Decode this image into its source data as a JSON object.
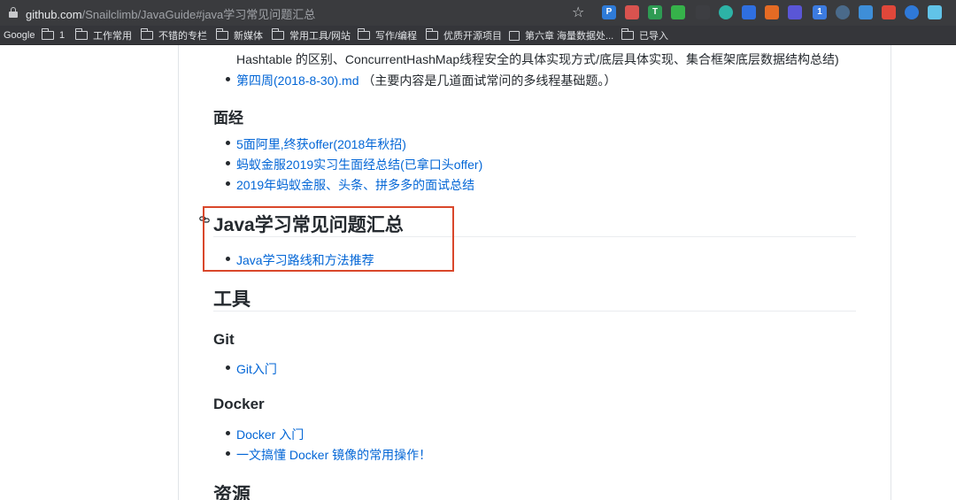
{
  "browser": {
    "url_host": "github.com",
    "url_path": "/Snailclimb/JavaGuide#java学习常见问题汇总",
    "extensions": [
      {
        "name": "p-icon",
        "label": "P",
        "color": "#2f7bd8"
      },
      {
        "name": "pdf-icon",
        "label": "",
        "color": "#d9534f"
      },
      {
        "name": "t-icon",
        "label": "T",
        "color": "#2e9b53"
      },
      {
        "name": "shield-play-icon",
        "label": "",
        "color": "#36b24a"
      },
      {
        "name": "diamond-icon",
        "label": "",
        "color": "#3d3e42"
      },
      {
        "name": "teal-circle-icon",
        "label": "",
        "color": "#2db3a6"
      },
      {
        "name": "blue-arrow-icon",
        "label": "",
        "color": "#2f6fe0"
      },
      {
        "name": "orange-face-icon",
        "label": "",
        "color": "#e56b24"
      },
      {
        "name": "moon-icon",
        "label": "",
        "color": "#5a56d6"
      },
      {
        "name": "badge-icon",
        "label": "1",
        "color": "#3c7be0"
      },
      {
        "name": "ring-icon",
        "label": "",
        "color": "#4a6a8a"
      },
      {
        "name": "grid-icon",
        "label": "",
        "color": "#3e8ed8"
      },
      {
        "name": "red-square-icon",
        "label": "",
        "color": "#e0473a"
      },
      {
        "name": "blue-ring-icon",
        "label": "",
        "color": "#2f79d8"
      },
      {
        "name": "react-icon",
        "label": "",
        "color": "#61c3e8"
      }
    ]
  },
  "bookmarks": [
    {
      "label": "Google",
      "icon": "none"
    },
    {
      "label": "1",
      "icon": "folder-icon"
    },
    {
      "label": "工作常用",
      "icon": "folder-icon"
    },
    {
      "label": "不错的专栏",
      "icon": "folder-icon"
    },
    {
      "label": "新媒体",
      "icon": "folder-icon"
    },
    {
      "label": "常用工具/网站",
      "icon": "folder-icon"
    },
    {
      "label": "写作/编程",
      "icon": "folder-icon"
    },
    {
      "label": "优质开源项目",
      "icon": "folder-icon"
    },
    {
      "label": "第六章 海量数据处...",
      "icon": "book-icon"
    },
    {
      "label": "已导入",
      "icon": "folder-icon"
    }
  ],
  "content": {
    "cut_line": "Hashtable 的区别、ConcurrentHashMap线程安全的具体实现方式/底层具体实现、集合框架底层数据结构总结)",
    "week4_link": "第四周(2018-8-30).md",
    "week4_text": "（主要内容是几道面试常问的多线程基础题。）",
    "mianjing_heading": "面经",
    "mianjing_items": [
      "5面阿里,终获offer(2018年秋招)",
      "蚂蚁金服2019实习生面经总结(已拿口头offer)",
      "2019年蚂蚁金服、头条、拼多多的面试总结"
    ],
    "java_heading": "Java学习常见问题汇总",
    "java_items": [
      "Java学习路线和方法推荐"
    ],
    "tools_heading": "工具",
    "git_heading": "Git",
    "git_items": [
      "Git入门"
    ],
    "docker_heading": "Docker",
    "docker_items": [
      "Docker 入门",
      "一文搞懂 Docker 镜像的常用操作！"
    ],
    "resources_heading": "资源"
  }
}
